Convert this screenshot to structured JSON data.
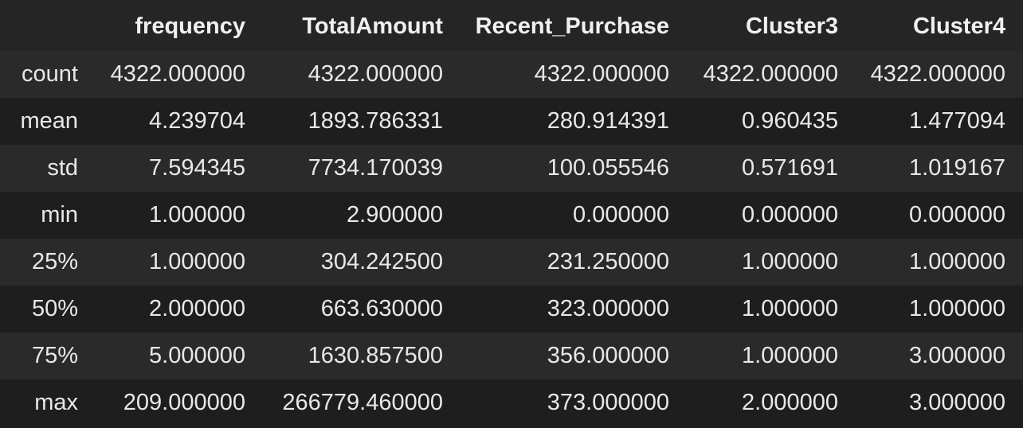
{
  "table": {
    "columns": [
      "",
      "frequency",
      "TotalAmount",
      "Recent_Purchase",
      "Cluster3",
      "Cluster4"
    ],
    "rows": [
      {
        "index": "count",
        "values": [
          "4322.000000",
          "4322.000000",
          "4322.000000",
          "4322.000000",
          "4322.000000"
        ]
      },
      {
        "index": "mean",
        "values": [
          "4.239704",
          "1893.786331",
          "280.914391",
          "0.960435",
          "1.477094"
        ]
      },
      {
        "index": "std",
        "values": [
          "7.594345",
          "7734.170039",
          "100.055546",
          "0.571691",
          "1.019167"
        ]
      },
      {
        "index": "min",
        "values": [
          "1.000000",
          "2.900000",
          "0.000000",
          "0.000000",
          "0.000000"
        ]
      },
      {
        "index": "25%",
        "values": [
          "1.000000",
          "304.242500",
          "231.250000",
          "1.000000",
          "1.000000"
        ]
      },
      {
        "index": "50%",
        "values": [
          "2.000000",
          "663.630000",
          "323.000000",
          "1.000000",
          "1.000000"
        ]
      },
      {
        "index": "75%",
        "values": [
          "5.000000",
          "1630.857500",
          "356.000000",
          "1.000000",
          "3.000000"
        ]
      },
      {
        "index": "max",
        "values": [
          "209.000000",
          "266779.460000",
          "373.000000",
          "2.000000",
          "3.000000"
        ]
      }
    ]
  },
  "colors": {
    "background": "#1e1e1e",
    "row_alt": "#2a2a2a",
    "text": "#e8e8e8"
  }
}
